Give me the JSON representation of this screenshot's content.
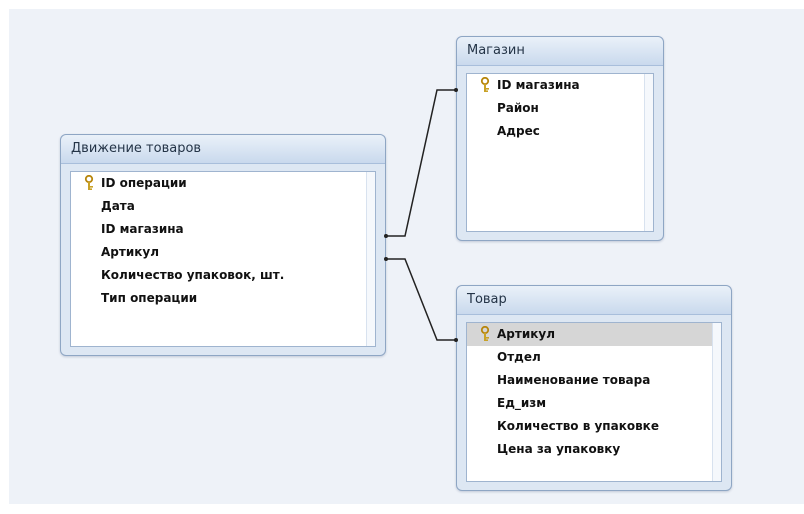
{
  "tables": {
    "movements": {
      "title": "Движение товаров",
      "fields": [
        "ID операции",
        "Дата",
        "ID магазина",
        "Артикул",
        "Количество упаковок, шт.",
        "Тип операции"
      ]
    },
    "store": {
      "title": "Магазин",
      "fields": [
        "ID магазина",
        "Район",
        "Адрес"
      ]
    },
    "product": {
      "title": "Товар",
      "fields": [
        "Артикул",
        "Отдел",
        "Наименование товара",
        "Ед_изм",
        "Количество в упаковке",
        "Цена за упаковку"
      ]
    }
  },
  "relationships": [
    {
      "from": "Движение товаров.ID магазина",
      "to": "Магазин.ID магазина"
    },
    {
      "from": "Движение товаров.Артикул",
      "to": "Товар.Артикул"
    }
  ],
  "icons": {
    "primary_key": "key-icon"
  },
  "colors": {
    "canvas": "#eef2f8",
    "title_bar": "#c9d9ed",
    "border": "#8ea6c4",
    "line": "#222222"
  }
}
